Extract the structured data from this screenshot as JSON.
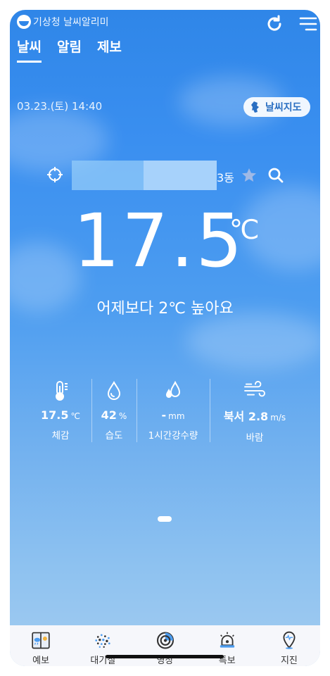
{
  "colors": {
    "sky_top": "#2f86e8",
    "sky_bottom": "#a3ccef",
    "accent": "#2a6fc2",
    "star": "#9fb9e6"
  },
  "header": {
    "brand": "기상청 날씨알리미",
    "refresh_icon": "refresh-icon",
    "menu_icon": "menu-icon"
  },
  "tabs": [
    {
      "label": "날씨",
      "active": true
    },
    {
      "label": "알림",
      "active": false
    },
    {
      "label": "제보",
      "active": false
    }
  ],
  "datetime": "03.23.(토) 14:40",
  "map_button": {
    "label": "날씨지도",
    "icon": "korea-map-icon"
  },
  "location": {
    "visible_suffix": "3동"
  },
  "current": {
    "temperature": "17.5",
    "unit": "℃",
    "comparison": "어제보다 2℃ 높아요"
  },
  "stats": [
    {
      "icon": "thermometer-icon",
      "value": "17.5",
      "unit": "℃",
      "label": "체감"
    },
    {
      "icon": "humidity-drop-icon",
      "value": "42",
      "unit": "%",
      "label": "습도"
    },
    {
      "icon": "rain-drops-icon",
      "value": "-",
      "unit": "mm",
      "label": "1시간강수량"
    },
    {
      "icon": "wind-icon",
      "value": "북서 2.8",
      "unit": "m/s",
      "label": "바람"
    }
  ],
  "bottom_nav": [
    {
      "label": "예보",
      "icon": "forecast-icon"
    },
    {
      "label": "대기질",
      "icon": "air-quality-icon"
    },
    {
      "label": "영상",
      "icon": "radar-icon"
    },
    {
      "label": "특보",
      "icon": "warning-siren-icon"
    },
    {
      "label": "지진",
      "icon": "earthquake-pin-icon"
    }
  ]
}
